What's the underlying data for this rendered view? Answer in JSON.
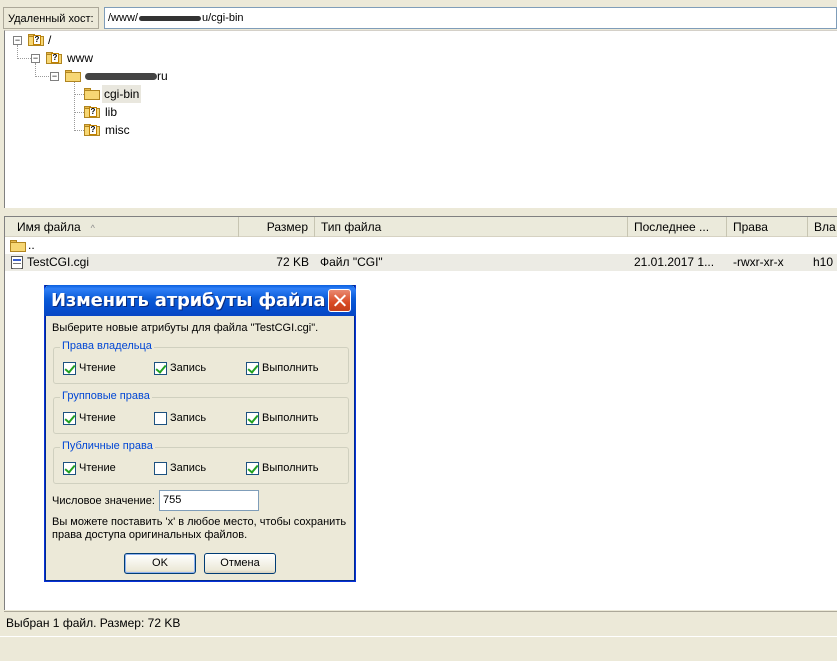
{
  "host": {
    "label": "Удаленный хост:",
    "path_prefix": "/www/",
    "path_suffix": "u/cgi-bin"
  },
  "tree": {
    "root": "/",
    "www": "www",
    "domain_suffix": "ru",
    "children": [
      "cgi-bin",
      "lib",
      "misc"
    ]
  },
  "columns": [
    "Имя файла",
    "Размер",
    "Тип файла",
    "Последнее ...",
    "Права",
    "Вла"
  ],
  "files": [
    {
      "name": "..",
      "size": "",
      "type": "",
      "modified": "",
      "perms": "",
      "owner": ""
    },
    {
      "name": "TestCGI.cgi",
      "size": "72 KB",
      "type": "Файл \"CGI\"",
      "modified": "21.01.2017 1...",
      "perms": "-rwxr-xr-x",
      "owner": "h10"
    }
  ],
  "status": "Выбран 1 файл. Размер: 72 KB",
  "dialog": {
    "title": "Изменить атрибуты файла",
    "intro": "Выберите новые атрибуты для файла \"TestCGI.cgi\".",
    "groups": [
      {
        "label": "Права владельца",
        "read": true,
        "write": true,
        "exec": true
      },
      {
        "label": "Групповые права",
        "read": true,
        "write": false,
        "exec": true
      },
      {
        "label": "Публичные права",
        "read": true,
        "write": false,
        "exec": true
      }
    ],
    "read_label": "Чтение",
    "write_label": "Запись",
    "exec_label": "Выполнить",
    "numeric_label": "Числовое значение:",
    "numeric_value": "755",
    "note": "Вы можете поставить 'x' в любое место, чтобы сохранить права доступа оригинальных файлов.",
    "ok": "OK",
    "cancel": "Отмена"
  }
}
